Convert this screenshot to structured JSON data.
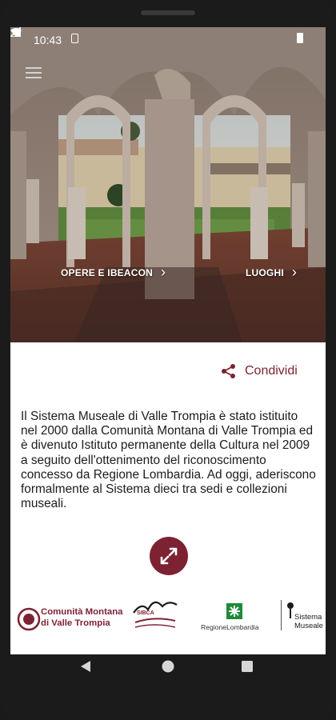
{
  "status_bar": {
    "time": "10:43"
  },
  "hero": {
    "link_opere": "OPERE E IBEACON",
    "link_luoghi": "LUOGHI",
    "chevron": "›"
  },
  "share": {
    "label": "Condividi",
    "icon": "share-icon"
  },
  "description": "Il Sistema Museale di Valle Trompia è stato istituito nel 2000 dalla Comunità Montana di Valle Trompia ed è divenuto Istituto permanente della Cultura nel 2009 a seguito dell'ottenimento del riconoscimento concesso da Regione Lombardia. Ad oggi, aderiscono formalmente al Sistema dieci tra sedi e collezioni museali.",
  "expand_button": {
    "icon": "expand-icon"
  },
  "logos": {
    "comunita_line1": "Comunità Montana",
    "comunita_line2": "di Valle Trompia",
    "sibca": "SIBCA",
    "regione": "RegioneLombardia",
    "sistema_line1": "Sistema",
    "sistema_line2": "Museale"
  },
  "colors": {
    "accent": "#7d2233",
    "text": "#1c1c1c"
  }
}
